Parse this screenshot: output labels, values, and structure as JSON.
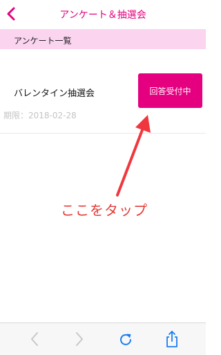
{
  "header": {
    "title": "アンケート＆抽選会",
    "back_icon": "chevron-left-icon"
  },
  "section": {
    "label": "アンケート一覧"
  },
  "survey_item": {
    "title": "バレンタイン抽選会",
    "period": "期限：2018-02-28",
    "status_button": "回答受付中"
  },
  "annotation": {
    "text": "ここをタップ",
    "color": "#e53935"
  },
  "toolbar": {
    "icons": [
      "back-arrow-icon",
      "forward-arrow-icon",
      "reload-icon",
      "share-icon"
    ]
  },
  "colors": {
    "accent": "#e5007f",
    "section_bg": "#fbd4f0",
    "toolbar_icon": "#1a7cf0",
    "toolbar_icon_disabled": "#c8c8c8"
  }
}
